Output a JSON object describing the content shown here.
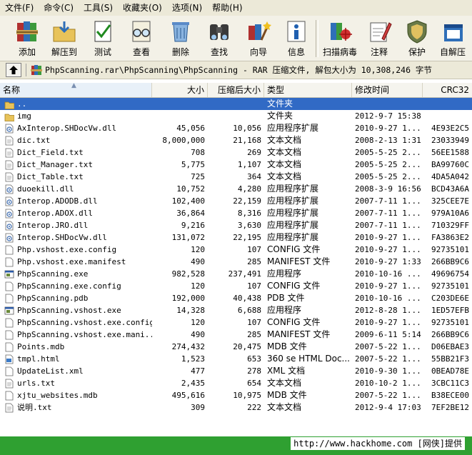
{
  "menu": [
    "文件(F)",
    "命令(C)",
    "工具(S)",
    "收藏夹(O)",
    "选项(N)",
    "帮助(H)"
  ],
  "toolbar": [
    {
      "label": "添加",
      "icon": "add-books-icon"
    },
    {
      "label": "解压到",
      "icon": "extract-folder-icon"
    },
    {
      "label": "测试",
      "icon": "test-check-icon"
    },
    {
      "label": "查看",
      "icon": "view-glasses-icon"
    },
    {
      "label": "删除",
      "icon": "delete-recycle-icon"
    },
    {
      "label": "查找",
      "icon": "find-binoculars-icon"
    },
    {
      "label": "向导",
      "icon": "wizard-icon"
    },
    {
      "label": "信息",
      "icon": "info-icon"
    },
    {
      "label": "扫描病毒",
      "icon": "scan-virus-icon"
    },
    {
      "label": "注释",
      "icon": "comment-icon"
    },
    {
      "label": "保护",
      "icon": "protect-shield-icon"
    },
    {
      "label": "自解压",
      "icon": "sfx-icon"
    }
  ],
  "address": "PhpScanning.rar\\PhpScanning\\PhpScanning - RAR 压缩文件, 解包大小为 10,308,246 字节",
  "columns": {
    "name": "名称",
    "size": "大小",
    "packed": "压缩后大小",
    "type": "类型",
    "modified": "修改时间",
    "crc": "CRC32"
  },
  "files": [
    {
      "name": "..",
      "size": "",
      "packed": "",
      "type": "文件夹",
      "modified": "",
      "crc": "",
      "icon": "folder-up-icon",
      "selected": true
    },
    {
      "name": "img",
      "size": "",
      "packed": "",
      "type": "文件夹",
      "modified": "2012-9-7 15:38",
      "crc": "",
      "icon": "folder-icon"
    },
    {
      "name": "AxInterop.SHDocVw.dll",
      "size": "45,056",
      "packed": "10,056",
      "type": "应用程序扩展",
      "modified": "2010-9-27 1...",
      "crc": "4E93E2C5",
      "icon": "dll-icon"
    },
    {
      "name": "dic.txt",
      "size": "8,000,000",
      "packed": "21,168",
      "type": "文本文档",
      "modified": "2008-2-13 1:31",
      "crc": "23033949",
      "icon": "text-file-icon"
    },
    {
      "name": "Dict_Field.txt",
      "size": "708",
      "packed": "269",
      "type": "文本文档",
      "modified": "2005-5-25 2...",
      "crc": "56EE1588",
      "icon": "text-file-icon"
    },
    {
      "name": "Dict_Manager.txt",
      "size": "5,775",
      "packed": "1,107",
      "type": "文本文档",
      "modified": "2005-5-25 2...",
      "crc": "BA99760C",
      "icon": "text-file-icon"
    },
    {
      "name": "Dict_Table.txt",
      "size": "725",
      "packed": "364",
      "type": "文本文档",
      "modified": "2005-5-25 2...",
      "crc": "4DA5A042",
      "icon": "text-file-icon"
    },
    {
      "name": "duoekill.dll",
      "size": "10,752",
      "packed": "4,280",
      "type": "应用程序扩展",
      "modified": "2008-3-9 16:56",
      "crc": "BCD43A6A",
      "icon": "dll-icon"
    },
    {
      "name": "Interop.ADODB.dll",
      "size": "102,400",
      "packed": "22,159",
      "type": "应用程序扩展",
      "modified": "2007-7-11 1...",
      "crc": "325CEE7E",
      "icon": "dll-icon"
    },
    {
      "name": "Interop.ADOX.dll",
      "size": "36,864",
      "packed": "8,316",
      "type": "应用程序扩展",
      "modified": "2007-7-11 1...",
      "crc": "979A10A6",
      "icon": "dll-icon"
    },
    {
      "name": "Interop.JRO.dll",
      "size": "9,216",
      "packed": "3,630",
      "type": "应用程序扩展",
      "modified": "2007-7-11 1...",
      "crc": "710329FF",
      "icon": "dll-icon"
    },
    {
      "name": "Interop.SHDocVw.dll",
      "size": "131,072",
      "packed": "22,195",
      "type": "应用程序扩展",
      "modified": "2010-9-27 1...",
      "crc": "FA3863E2",
      "icon": "dll-icon"
    },
    {
      "name": "Php.vshost.exe.config",
      "size": "120",
      "packed": "107",
      "type": "CONFIG 文件",
      "modified": "2010-9-27 1...",
      "crc": "92735101",
      "icon": "generic-file-icon"
    },
    {
      "name": "Php.vshost.exe.manifest",
      "size": "490",
      "packed": "285",
      "type": "MANIFEST 文件",
      "modified": "2010-9-27 1:33",
      "crc": "266BB9C6",
      "icon": "generic-file-icon"
    },
    {
      "name": "PhpScanning.exe",
      "size": "982,528",
      "packed": "237,491",
      "type": "应用程序",
      "modified": "2010-10-16 ...",
      "crc": "49696754",
      "icon": "exe-icon"
    },
    {
      "name": "PhpScanning.exe.config",
      "size": "120",
      "packed": "107",
      "type": "CONFIG 文件",
      "modified": "2010-9-27 1...",
      "crc": "92735101",
      "icon": "generic-file-icon"
    },
    {
      "name": "PhpScanning.pdb",
      "size": "192,000",
      "packed": "40,438",
      "type": "PDB 文件",
      "modified": "2010-10-16 ...",
      "crc": "C203DE6E",
      "icon": "generic-file-icon"
    },
    {
      "name": "PhpScanning.vshost.exe",
      "size": "14,328",
      "packed": "6,688",
      "type": "应用程序",
      "modified": "2012-8-28 1...",
      "crc": "1ED57EFB",
      "icon": "exe-icon"
    },
    {
      "name": "PhpScanning.vshost.exe.config",
      "size": "120",
      "packed": "107",
      "type": "CONFIG 文件",
      "modified": "2010-9-27 1...",
      "crc": "92735101",
      "icon": "generic-file-icon"
    },
    {
      "name": "PhpScanning.vshost.exe.mani...",
      "size": "490",
      "packed": "285",
      "type": "MANIFEST 文件",
      "modified": "2009-6-11 5:14",
      "crc": "266BB9C6",
      "icon": "generic-file-icon"
    },
    {
      "name": "Points.mdb",
      "size": "274,432",
      "packed": "20,475",
      "type": "MDB 文件",
      "modified": "2007-5-22 1...",
      "crc": "D06EBAE3",
      "icon": "generic-file-icon"
    },
    {
      "name": "tmpl.html",
      "size": "1,523",
      "packed": "653",
      "type": "360 se HTML Doc...",
      "modified": "2007-5-22 1...",
      "crc": "55BB21F3",
      "icon": "html-file-icon"
    },
    {
      "name": "UpdateList.xml",
      "size": "477",
      "packed": "278",
      "type": "XML 文档",
      "modified": "2010-9-30 1...",
      "crc": "0BEAD78E",
      "icon": "generic-file-icon"
    },
    {
      "name": "urls.txt",
      "size": "2,435",
      "packed": "654",
      "type": "文本文档",
      "modified": "2010-10-2 1...",
      "crc": "3CBC11C3",
      "icon": "text-file-icon"
    },
    {
      "name": "xjtu_websites.mdb",
      "size": "495,616",
      "packed": "10,975",
      "type": "MDB 文件",
      "modified": "2007-5-22 1...",
      "crc": "B38ECE00",
      "icon": "generic-file-icon"
    },
    {
      "name": "说明.txt",
      "size": "309",
      "packed": "222",
      "type": "文本文档",
      "modified": "2012-9-4 17:03",
      "crc": "7EF2BE12",
      "icon": "text-file-icon"
    }
  ],
  "watermark": "http://www.hackhome.com [网侠]提供",
  "colors": {
    "selection": "#316ac5",
    "status_bar": "#2fa031",
    "folder": "#e8c35a"
  }
}
